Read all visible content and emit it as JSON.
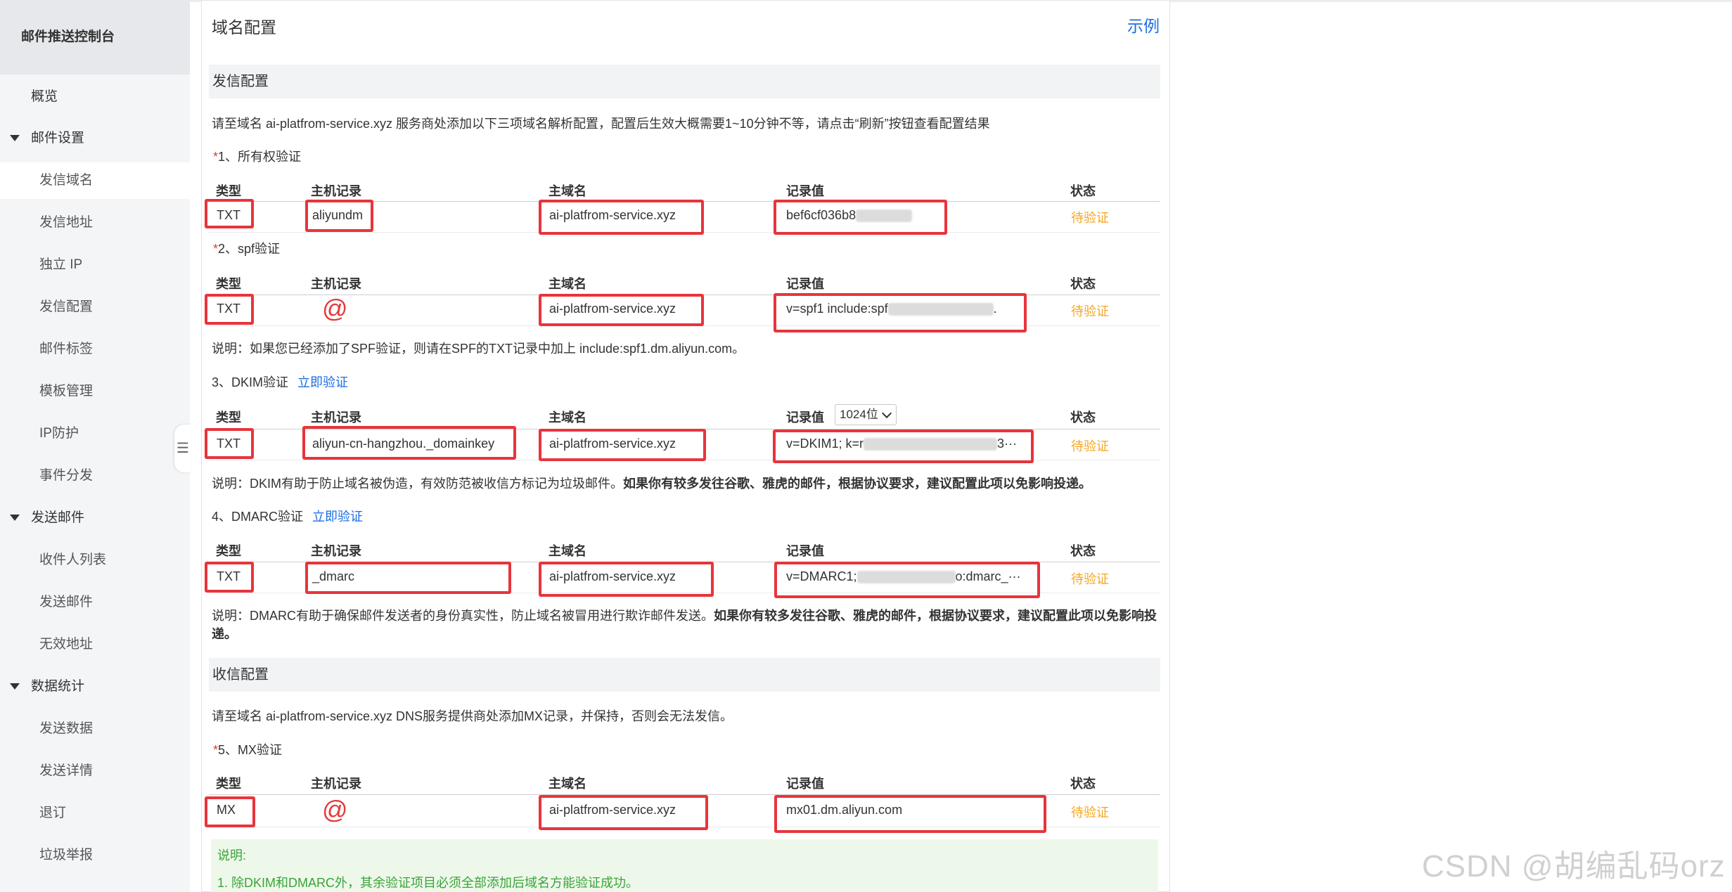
{
  "sidebar": {
    "title": "邮件推送控制台",
    "overview": "概览",
    "groups": [
      {
        "label": "邮件设置",
        "items": [
          "发信域名",
          "发信地址",
          "独立 IP",
          "发信配置",
          "邮件标签",
          "模板管理",
          "IP防护",
          "事件分发"
        ]
      },
      {
        "label": "发送邮件",
        "items": [
          "收件人列表",
          "发送邮件",
          "无效地址"
        ]
      },
      {
        "label": "数据统计",
        "items": [
          "发送数据",
          "发送详情",
          "退订",
          "垃圾举报"
        ]
      }
    ],
    "active_item": "发信域名",
    "collapse_icon": "list-icon"
  },
  "main": {
    "title": "域名配置",
    "example_link": "示例",
    "send_section": {
      "title": "发信配置",
      "intro": "请至域名 ai-platfrom-service.xyz 服务商处添加以下三项域名解析配置，配置后生效大概需要1~10分钟不等，请点击“刷新”按钮查看配置结果"
    },
    "headers": {
      "type": "类型",
      "host": "主机记录",
      "domain": "主域名",
      "value": "记录值",
      "status": "状态"
    },
    "records": [
      {
        "star": "*",
        "title": "1、所有权验证",
        "type": "TXT",
        "host": "aliyundm",
        "domain": "ai-platfrom-service.xyz",
        "value": "bef6cf036b8",
        "status": "待验证"
      },
      {
        "star": "*",
        "title": "2、spf验证",
        "type": "TXT",
        "host": "@",
        "domain": "ai-platfrom-service.xyz",
        "value": "v=spf1 include:spf",
        "value_end": ".",
        "status": "待验证",
        "note": "说明：如果您已经添加了SPF验证，则请在SPF的TXT记录中加上 include:spf1.dm.aliyun.com。"
      },
      {
        "title": "3、DKIM验证",
        "verify_link": "立即验证",
        "type": "TXT",
        "host": "aliyun-cn-hangzhou._domainkey",
        "domain": "ai-platfrom-service.xyz",
        "value": "v=DKIM1; k=r",
        "value_end": "3···",
        "status": "待验证",
        "key_length": "1024位",
        "note": "说明：DKIM有助于防止域名被伪造，有效防范被收信方标记为垃圾邮件。",
        "note_bold": "如果你有较多发往谷歌、雅虎的邮件，根据协议要求，建议配置此项以免影响投递。"
      },
      {
        "title": "4、DMARC验证",
        "verify_link": "立即验证",
        "type": "TXT",
        "host": "_dmarc",
        "domain": "ai-platfrom-service.xyz",
        "value": "v=DMARC1;",
        "value_end": "o:dmarc_···",
        "status": "待验证",
        "note": "说明：DMARC有助于确保邮件发送者的身份真实性，防止域名被冒用进行欺诈邮件发送。",
        "note_bold": "如果你有较多发往谷歌、雅虎的邮件，根据协议要求，建议配置此项以免影响投",
        "note_bold2": "递。"
      }
    ],
    "receive_section": {
      "title": "收信配置",
      "intro": "请至域名 ai-platfrom-service.xyz DNS服务提供商处添加MX记录，并保持，否则会无法发信。"
    },
    "mx_record": {
      "star": "*",
      "title": "5、MX验证",
      "type": "MX",
      "host": "@",
      "domain": "ai-platfrom-service.xyz",
      "value": "mx01.dm.aliyun.com",
      "status": "待验证"
    },
    "bottom_note": {
      "title": "说明:",
      "line1": "1. 除DKIM和DMARC外，其余验证项目必须全部添加后域名方能验证成功。"
    }
  },
  "watermark": "CSDN @胡编乱码orz",
  "colors": {
    "accent": "#ff6a00",
    "link": "#1b6ee6",
    "pending": "#f5a623",
    "highlight_box": "#e8343c"
  }
}
